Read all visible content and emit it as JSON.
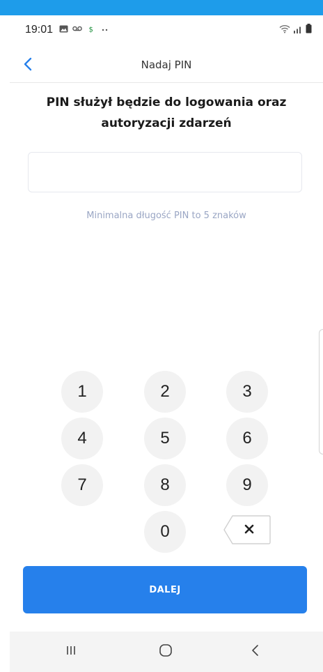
{
  "status_bar": {
    "time": "19:01",
    "left_icons": [
      "image-icon",
      "voicemail-icon",
      "dollar-icon",
      "more-dots-icon"
    ],
    "right_icons": [
      "wifi-icon",
      "signal-icon",
      "battery-icon"
    ]
  },
  "app_bar": {
    "title": "Nadaj PIN",
    "back_icon": "chevron-left-icon"
  },
  "heading": {
    "line1": "PIN służył będzie do logowania oraz",
    "line2": "autoryzacji zdarzeń"
  },
  "pin_input": {
    "value": "",
    "placeholder": ""
  },
  "hint": "Minimalna długość PIN to 5 znaków",
  "keypad": {
    "keys": [
      "1",
      "2",
      "3",
      "4",
      "5",
      "6",
      "7",
      "8",
      "9",
      "0"
    ],
    "backspace_icon": "backspace-icon"
  },
  "next_button": {
    "label": "DALEJ"
  },
  "nav_bar": {
    "icons": [
      "recents-icon",
      "home-icon",
      "back-icon"
    ]
  },
  "colors": {
    "accent": "#2680eb",
    "top_accent": "#1e9cea",
    "hint_text": "#9aa6c4",
    "key_bg": "#f2f2f2",
    "nav_bg": "#f4f4f4"
  }
}
